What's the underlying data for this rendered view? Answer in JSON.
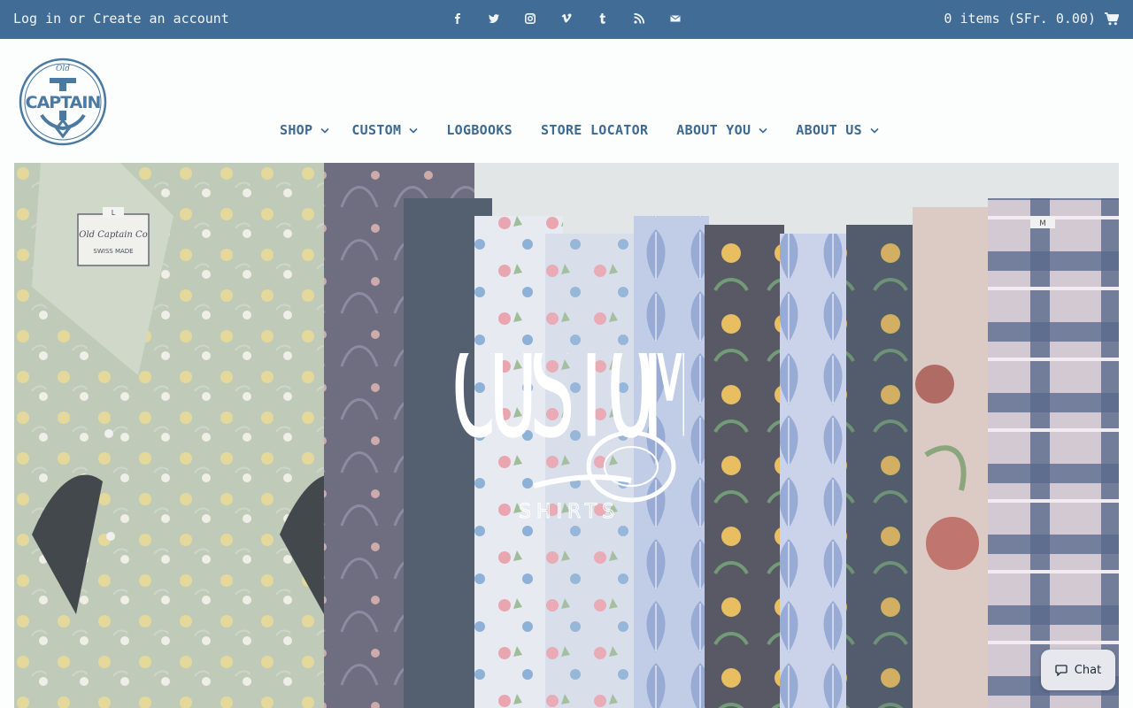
{
  "topbar": {
    "login_label": "Log in",
    "or_label": "or",
    "create_account_label": "Create an account",
    "social_icons": [
      "facebook-icon",
      "twitter-icon",
      "instagram-icon",
      "vimeo-icon",
      "tumblr-icon",
      "rss-icon",
      "email-icon"
    ],
    "cart_label": "0 items (SFr. 0.00)"
  },
  "logo": {
    "alt_text": "Old Captain",
    "small_text": "Old",
    "main_text": "CAPTAIN"
  },
  "nav": {
    "items": [
      {
        "label": "SHOP",
        "dropdown": true
      },
      {
        "label": "CUSTOM",
        "dropdown": true
      },
      {
        "label": "LOGBOOKS",
        "dropdown": false
      },
      {
        "label": "STORE LOCATOR",
        "dropdown": false
      },
      {
        "label": "ABOUT YOU",
        "dropdown": true
      },
      {
        "label": "ABOUT US",
        "dropdown": true
      }
    ]
  },
  "hero": {
    "title": "CUSTOM",
    "subtitle": "SHIRTS",
    "label_text": "Old Captain Co",
    "label_sub": "SWISS MADE",
    "size_tag_l": "L",
    "size_tag_m": "M"
  },
  "chat": {
    "label": "Chat"
  },
  "colors": {
    "topbar": "#416c95",
    "nav_text": "#3d6a93",
    "page_bg": "#fcfdfd"
  }
}
